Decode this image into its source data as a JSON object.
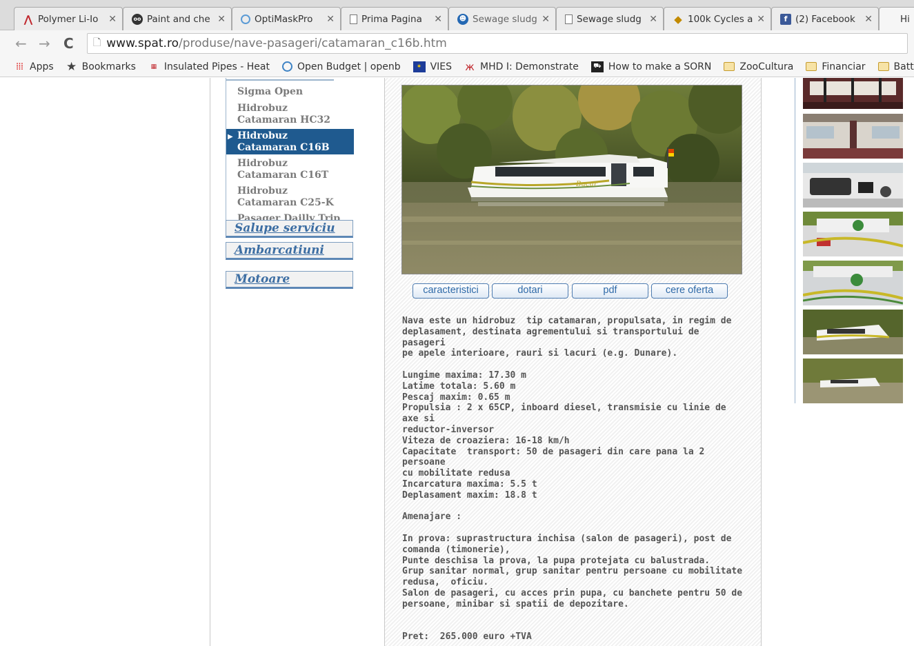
{
  "browser": {
    "tabs": [
      {
        "title": "Polymer Li-Io",
        "icon": "pdf-red-icon"
      },
      {
        "title": "Paint and che",
        "icon": "glasses-icon"
      },
      {
        "title": "OptiMaskPro",
        "icon": "optimask-icon"
      },
      {
        "title": "Prima Pagina",
        "icon": "page-icon"
      },
      {
        "title": "Sewage sludg",
        "icon": "accessibility-icon"
      },
      {
        "title": "Sewage sludg",
        "icon": "page-icon"
      },
      {
        "title": "100k Cycles a",
        "icon": "diamond-icon"
      },
      {
        "title": "(2) Facebook",
        "icon": "facebook-icon"
      },
      {
        "title": "Hi",
        "icon": ""
      }
    ],
    "url_host": "www.spat.ro",
    "url_path": "/produse/nave-pasageri/catamaran_c16b.htm",
    "bookmarks": [
      {
        "label": "Apps",
        "icon": "apps-grid-icon"
      },
      {
        "label": "Bookmarks",
        "icon": "star-icon"
      },
      {
        "label": "Insulated Pipes - Heat",
        "icon": "toolbox-icon"
      },
      {
        "label": "Open Budget | openb",
        "icon": "globe-icon"
      },
      {
        "label": "VIES",
        "icon": "eu-flag-icon"
      },
      {
        "label": "MHD I: Demonstrate",
        "icon": "mhd-icon"
      },
      {
        "label": "How to make a SORN",
        "icon": "car-icon"
      },
      {
        "label": "ZooCultura",
        "icon": "folder-icon"
      },
      {
        "label": "Financiar",
        "icon": "folder-icon"
      },
      {
        "label": "Battery Stuff",
        "icon": "folder-icon"
      }
    ]
  },
  "sidebar": {
    "subitems": [
      {
        "label": "Sigma Open",
        "active": false
      },
      {
        "label": "Hidrobuz Catamaran HC32",
        "active": false
      },
      {
        "label": "Hidrobuz Catamaran C16B",
        "active": true
      },
      {
        "label": "Hidrobuz Catamaran C16T",
        "active": false
      },
      {
        "label": "Hidrobuz Catamaran C25-K",
        "active": false
      },
      {
        "label": "Pasager Dailly Trip",
        "active": false
      }
    ],
    "categories": [
      "Salupe serviciu",
      "Ambarcatiuni",
      "Motoare"
    ]
  },
  "content": {
    "tabs": [
      "caracteristici",
      "dotari",
      "pdf",
      "cere oferta"
    ],
    "boat_name": "Bucur",
    "description": "Nava este un hidrobuz  tip catamaran, propulsata, in regim de\ndeplasament, destinata agrementului si transportului de pasageri\npe apele interioare, rauri si lacuri (e.g. Dunare).\n\nLungime maxima: 17.30 m\nLatime totala: 5.60 m\nPescaj maxim: 0.65 m\nPropulsia : 2 x 65CP, inboard diesel, transmisie cu linie de axe si\nreductor-inversor\nViteza de croaziera: 16-18 km/h\nCapacitate  transport: 50 de pasageri din care pana la 2 persoane\ncu mobilitate redusa\nIncarcatura maxima: 5.5 t\nDeplasament maxim: 18.8 t\n\nAmenajare :\n\nIn prova: suprastructura inchisa (salon de pasageri), post de\ncomanda (timonerie),\nPunte deschisa la prova, la pupa protejata cu balustrada.\nGrup sanitar normal, grup sanitar pentru persoane cu mobilitate\nredusa,  oficiu.\nSalon de pasageri, cu acces prin pupa, cu banchete pentru 50 de\npersoane, minibar si spatii de depozitare.\n\n\nPret:  265.000 euro +TVA"
  }
}
